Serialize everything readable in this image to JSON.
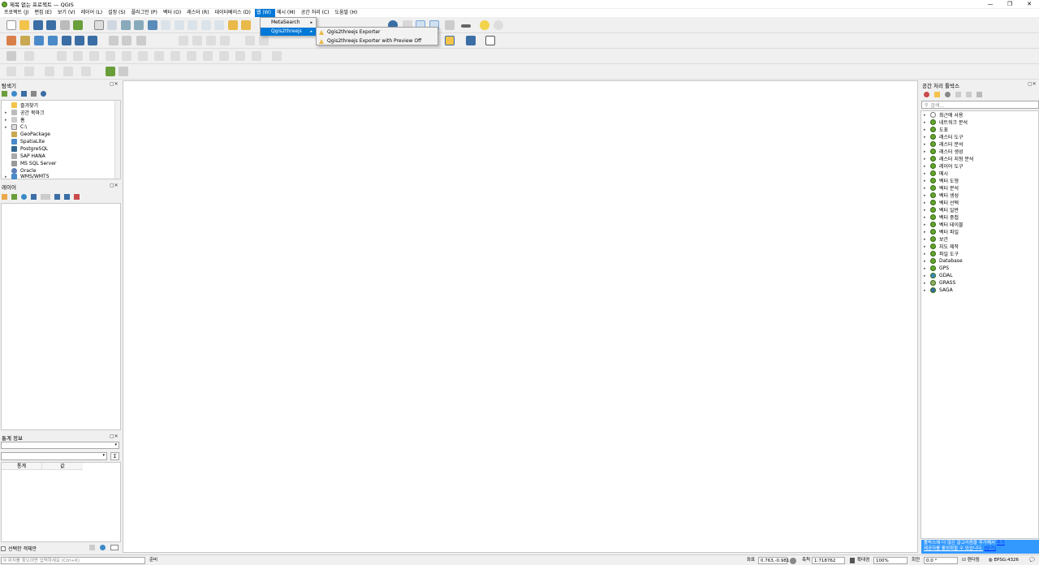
{
  "window": {
    "title": "제목 없는 프로젝트 — QGIS",
    "controls": [
      "—",
      "❐",
      "✕"
    ]
  },
  "menubar": [
    "프로젝트 (J)",
    "편집 (E)",
    "보기 (V)",
    "레이어 (L)",
    "설정 (S)",
    "플러그인 (P)",
    "벡터 (O)",
    "래스터 (R)",
    "데이터베이스 (D)",
    "웹 (W)",
    "메시 (M)",
    "공간 처리 (C)",
    "도움말 (H)"
  ],
  "web_menu": {
    "items": [
      "MetaSearch",
      "Qgis2threejs"
    ],
    "submenu": [
      "Qgis2threejs Exporter",
      "Qgis2threejs Exporter with Preview Off"
    ]
  },
  "browser_panel": {
    "title": "탐색기",
    "items": [
      "즐겨찾기",
      "공간 북마크",
      "홈",
      "C:\\",
      "GeoPackage",
      "SpatiaLite",
      "PostgreSQL",
      "SAP HANA",
      "MS SQL Server",
      "Oracle",
      "WMS/WMTS"
    ]
  },
  "layers_panel": {
    "title": "레이어"
  },
  "stats_panel": {
    "title": "통계 정보",
    "columns": [
      "통계",
      "값"
    ],
    "selected_only": "선택한 객체만",
    "sigma": "Σ"
  },
  "processing_panel": {
    "title": "공간 처리 툴박스",
    "search_placeholder": "검색...",
    "items": [
      "최근에 사용",
      "네트워크 분석",
      "도표",
      "래스터 도구",
      "래스터 분석",
      "래스터 생성",
      "래스터 지형 분석",
      "레이어 도구",
      "메시",
      "벡터 도형",
      "벡터 분석",
      "벡터 생성",
      "벡터 선택",
      "벡터 일반",
      "벡터 중첩",
      "벡터 테이블",
      "벡터 파일",
      "보간",
      "지도 제작",
      "파일 도구",
      "Database",
      "GPS",
      "GDAL",
      "GRASS",
      "SAGA"
    ],
    "notice": "툴박스에 더 많은 알고리즘을 추가해서",
    "notice_link1": "추가",
    "notice_line2": "제공자를 활성화할 수 있습니다.",
    "notice_link2": "[닫기]"
  },
  "statusbar": {
    "locator_placeholder": "위치를 찾으려면 입력하세요 (Ctrl+K)",
    "ready": "준비",
    "coord_label": "좌표",
    "coord_value": "0.763,-0.981",
    "scale_label": "축척",
    "scale_value": "1:718762",
    "magnifier_label": "확대경",
    "magnifier_value": "100%",
    "rotation_label": "회전",
    "rotation_value": "0.0 °",
    "render_label": "렌더링",
    "crs": "EPSG:4326"
  },
  "colors": {
    "accent": "#0078d7",
    "qgis_green": "#67a32f",
    "notice_bg": "#3399ff"
  }
}
